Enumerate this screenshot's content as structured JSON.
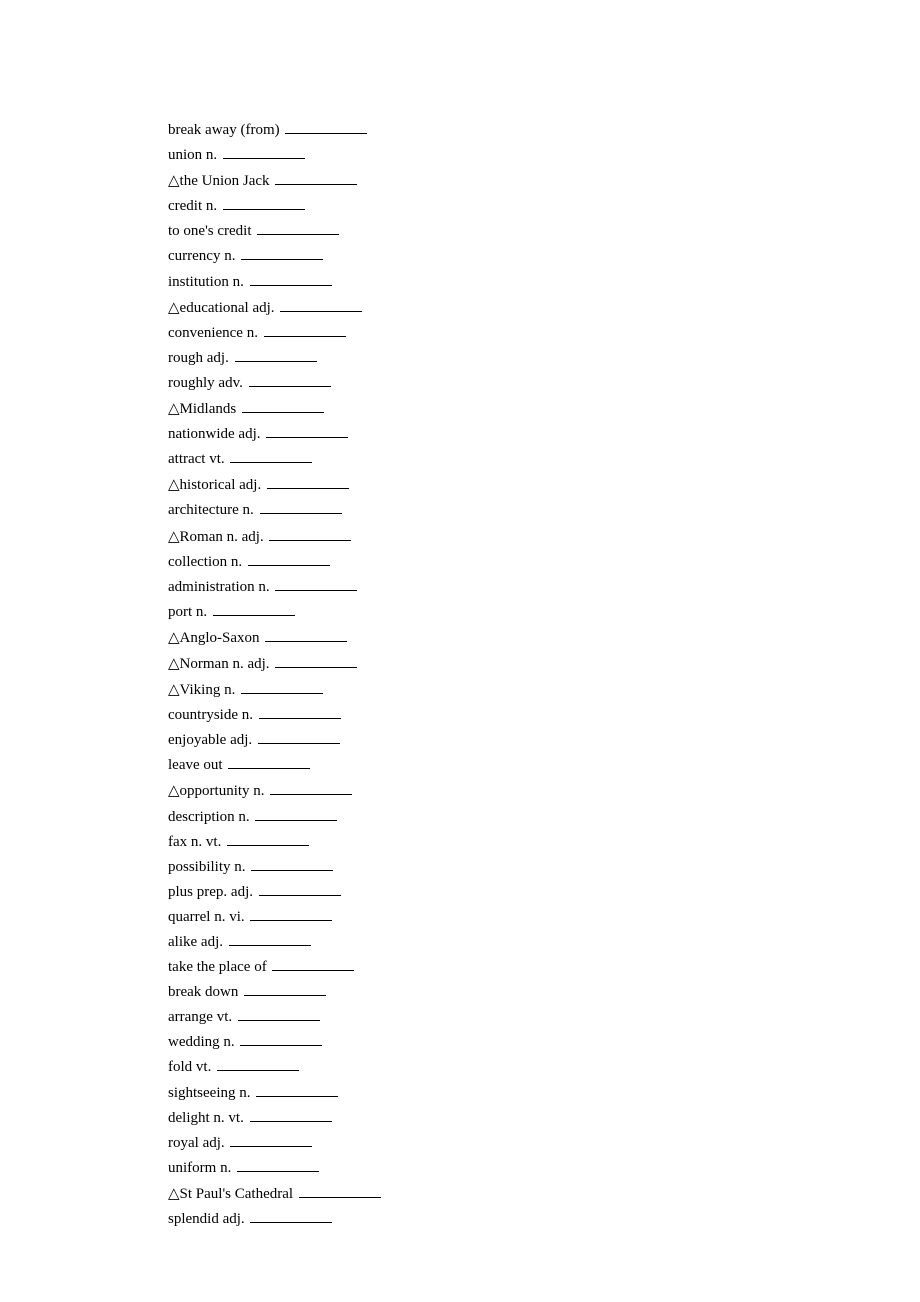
{
  "entries": [
    {
      "term": "break away (from)",
      "pos": ""
    },
    {
      "term": "union",
      "pos": "n."
    },
    {
      "term": "△the Union Jack",
      "pos": ""
    },
    {
      "term": "credit",
      "pos": "n."
    },
    {
      "term": "to one's credit",
      "pos": ""
    },
    {
      "term": "currency",
      "pos": "n."
    },
    {
      "term": "institution",
      "pos": "n."
    },
    {
      "term": "△educational",
      "pos": "adj."
    },
    {
      "term": "convenience",
      "pos": "n."
    },
    {
      "term": "rough",
      "pos": "adj."
    },
    {
      "term": "roughly",
      "pos": "adv."
    },
    {
      "term": "△Midlands",
      "pos": ""
    },
    {
      "term": "nationwide",
      "pos": "adj."
    },
    {
      "term": "attract",
      "pos": "vt."
    },
    {
      "term": "△historical",
      "pos": "adj."
    },
    {
      "term": "architecture",
      "pos": "n."
    },
    {
      "term": "△Roman",
      "pos": "n. adj."
    },
    {
      "term": "collection",
      "pos": "n."
    },
    {
      "term": "administration",
      "pos": "n."
    },
    {
      "term": "port",
      "pos": "n."
    },
    {
      "term": "△Anglo-Saxon",
      "pos": ""
    },
    {
      "term": "△Norman",
      "pos": "n. adj."
    },
    {
      "term": "△Viking",
      "pos": "n."
    },
    {
      "term": "countryside",
      "pos": "n."
    },
    {
      "term": "enjoyable",
      "pos": "adj."
    },
    {
      "term": "leave out",
      "pos": ""
    },
    {
      "term": "△opportunity",
      "pos": "n."
    },
    {
      "term": "description",
      "pos": "n."
    },
    {
      "term": "fax",
      "pos": "n.   vt."
    },
    {
      "term": "possibility",
      "pos": "n."
    },
    {
      "term": "plus",
      "pos": "prep.   adj."
    },
    {
      "term": "quarrel",
      "pos": "n.      vi."
    },
    {
      "term": "alike",
      "pos": "adj."
    },
    {
      "term": "take the place of",
      "pos": ""
    },
    {
      "term": "break down",
      "pos": ""
    },
    {
      "term": "arrange",
      "pos": "vt."
    },
    {
      "term": "wedding",
      "pos": "n."
    },
    {
      "term": "fold",
      "pos": "vt."
    },
    {
      "term": "sightseeing",
      "pos": "n."
    },
    {
      "term": "delight",
      "pos": "n.    vt."
    },
    {
      "term": "royal",
      "pos": "adj."
    },
    {
      "term": "uniform",
      "pos": "n."
    },
    {
      "term": "△St Paul's Cathedral",
      "pos": ""
    },
    {
      "term": "splendid",
      "pos": "adj."
    }
  ]
}
